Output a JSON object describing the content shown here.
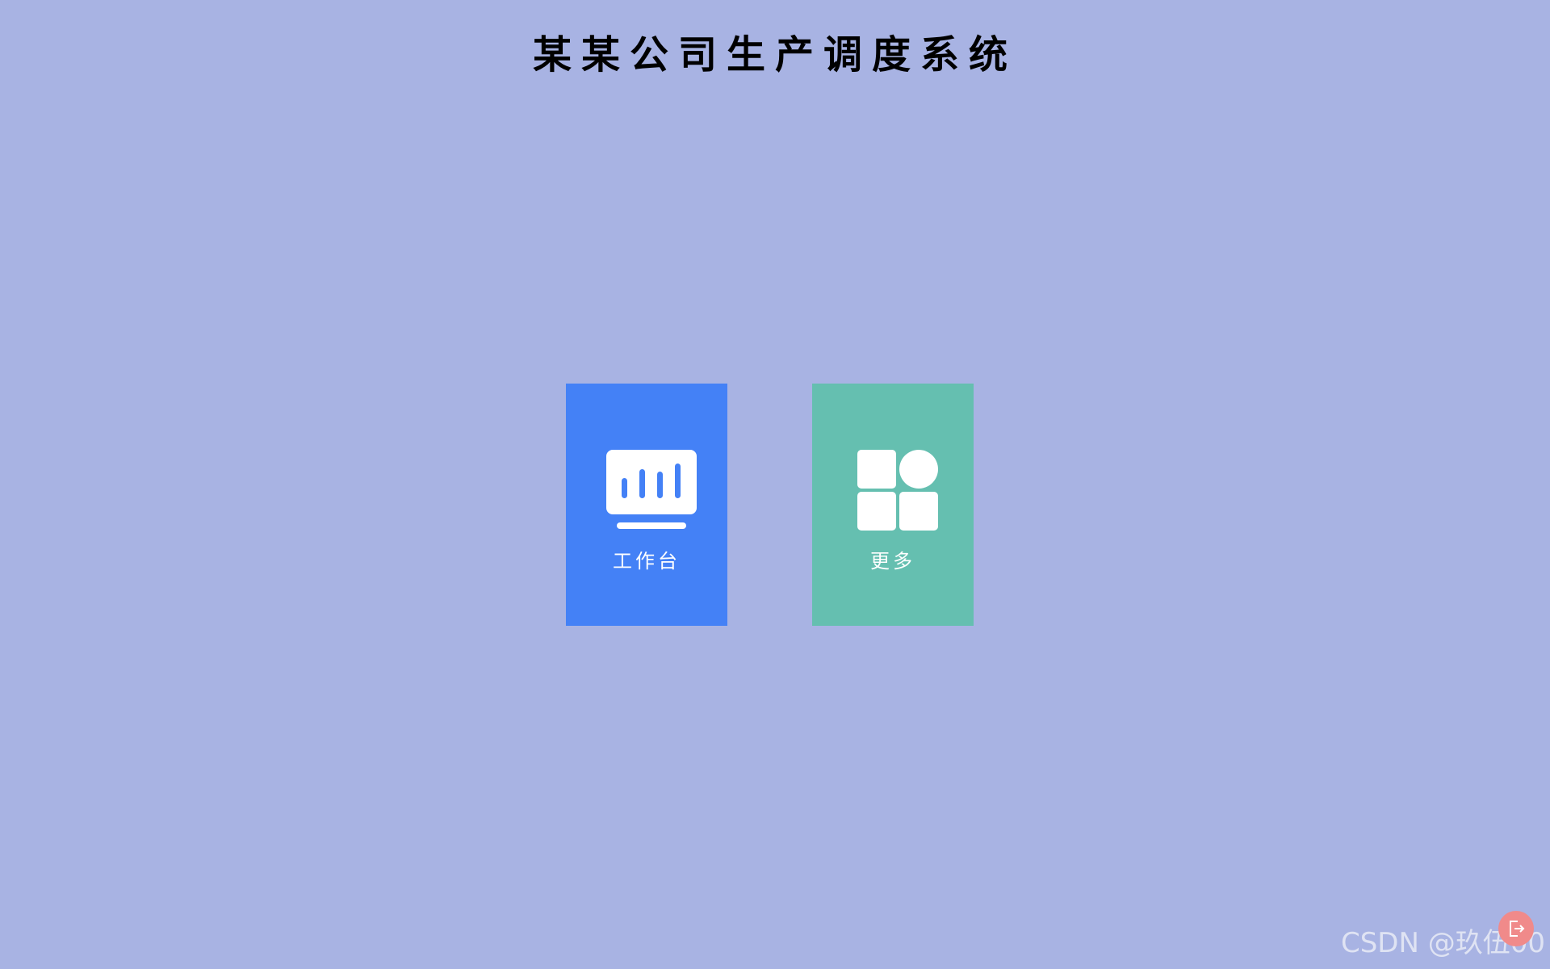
{
  "header": {
    "title": "某某公司生产调度系统"
  },
  "tiles": [
    {
      "label": "工作台",
      "icon": "dashboard-monitor-icon",
      "color": "#4481f6"
    },
    {
      "label": "更多",
      "icon": "apps-grid-icon",
      "color": "#65bfb0"
    }
  ],
  "floating_button": {
    "icon": "exit-icon",
    "color": "#f08a8a"
  },
  "watermark": {
    "text": "CSDN @玖伍00"
  },
  "colors": {
    "background": "#a8b3e3",
    "title": "#000000",
    "tile_text": "#ffffff"
  }
}
